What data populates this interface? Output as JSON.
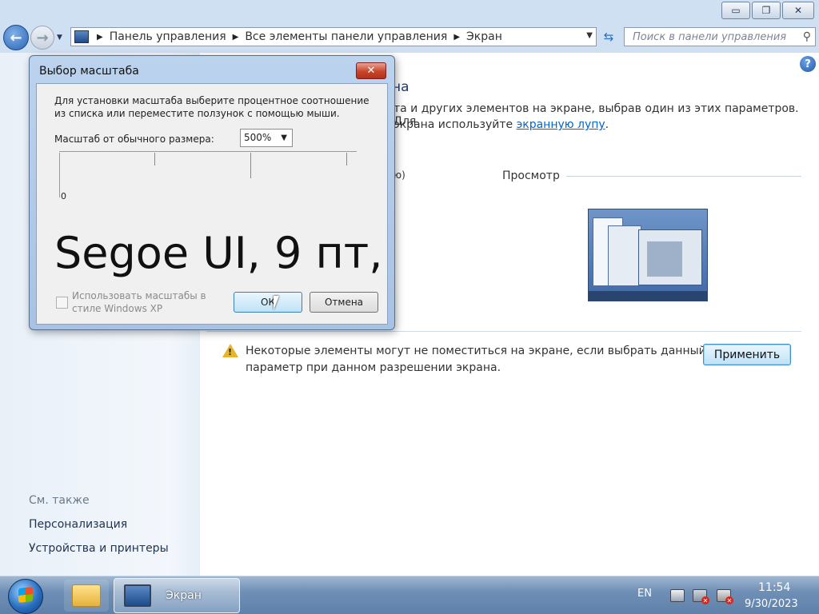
{
  "window": {
    "caption_minimize": "▭",
    "caption_maximize": "❐",
    "caption_close": "✕"
  },
  "nav": {
    "breadcrumb": [
      "Панель управления",
      "Все элементы панели управления",
      "Экран"
    ],
    "search_placeholder": "Поиск в панели управления"
  },
  "sidebar": {
    "see_also": "См. также",
    "links": [
      "Персонализация",
      "Устройства и принтеры"
    ]
  },
  "main": {
    "title_fragment": "на",
    "description_line1": "та и других элементов на экране, выбрав один из этих параметров. Для",
    "description_line2_prefix": "экрана используйте ",
    "description_link": "экранную лупу",
    "description_line2_suffix": ".",
    "option_fragment": "ю)",
    "preview_label": "Просмотр",
    "warning_line1": "Некоторые элементы могут не поместиться на экране, если выбрать данный",
    "warning_line2": "параметр при данном разрешении экрана.",
    "apply_button": "Применить"
  },
  "dialog": {
    "title": "Выбор масштаба",
    "instructions_line1": "Для установки масштаба выберите процентное соотношение",
    "instructions_line2": "из списка или переместите ползунок с помощью мыши.",
    "scale_label": "Масштаб от обычного размера:",
    "scale_value": "500%",
    "ruler_zero": "0",
    "sample_text": "Segoe UI, 9 пт,",
    "xp_checkbox_line1": "Использовать масштабы в",
    "xp_checkbox_line2": "стиле Windows XP",
    "xp_checkbox_checked": false,
    "ok_button": "ОК",
    "cancel_button": "Отмена"
  },
  "taskbar": {
    "active_window_label": "Экран",
    "language": "EN",
    "time": "11:54",
    "date": "9/30/2023"
  },
  "colors": {
    "accent": "#3c8fd0",
    "link": "#0066cc",
    "close_red": "#c8442a"
  }
}
